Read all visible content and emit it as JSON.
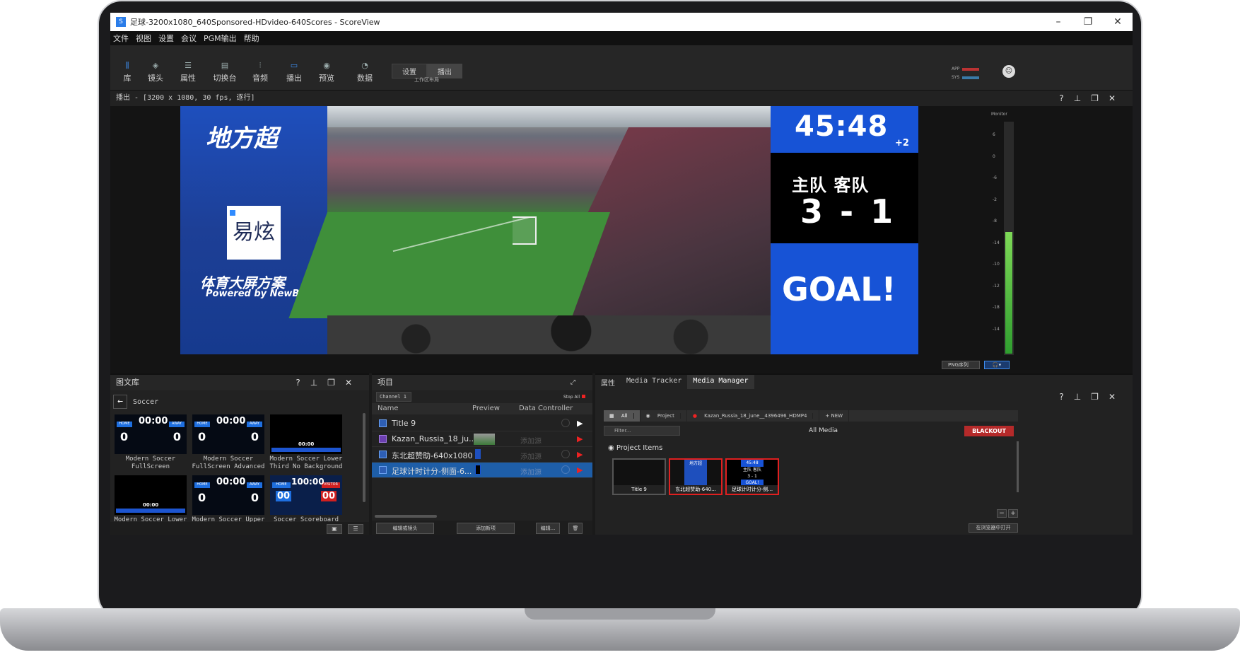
{
  "window": {
    "title": "足球-3200x1080_640Sponsored-HDvideo-640Scores - ScoreView",
    "app_icon": "scoreview-app-icon"
  },
  "menu": [
    "文件",
    "视图",
    "设置",
    "会议",
    "PGM输出",
    "帮助"
  ],
  "toolbar": {
    "tools": [
      {
        "label": "库",
        "icon": "library-icon"
      },
      {
        "label": "镜头",
        "icon": "layers-icon"
      },
      {
        "label": "属性",
        "icon": "list-icon"
      },
      {
        "label": "切换台",
        "icon": "switcher-icon"
      },
      {
        "label": "音频",
        "icon": "audio-sliders-icon"
      },
      {
        "label": "播出",
        "icon": "monitor-icon"
      },
      {
        "label": "预览",
        "icon": "eye-icon"
      },
      {
        "label": "数据",
        "icon": "data-icon"
      }
    ],
    "layout_tabs": [
      "设置",
      "播出"
    ],
    "layout_caption": "工作区布局",
    "meters": [
      "APP",
      "SYS"
    ]
  },
  "program": {
    "header": "播出 - [3200 x 1080, 30 fps, 逐行]",
    "left": {
      "title": "地方超",
      "logo_text": "易炫",
      "subtitle": "体育大屏方案",
      "powered": "Powered by NewBlue"
    },
    "right": {
      "clock": "45:48",
      "added": "+2",
      "teams": "主队  客队",
      "score": "3 - 1",
      "goal": "GOAL!"
    },
    "monitor": {
      "title": "Monitor",
      "scale": [
        "6",
        "0",
        "-6",
        "-2",
        "-8",
        "-14",
        "-10",
        "-12",
        "-18",
        "-14"
      ]
    },
    "png_button": "PNG序列"
  },
  "library": {
    "title": "图文库",
    "folder": "Soccer",
    "items": [
      {
        "label": "Modern Soccer FullScreen",
        "clock": "00:00",
        "home": "0",
        "away": "0"
      },
      {
        "label": "Modern Soccer FullScreen Advanced",
        "clock": "00:00",
        "home": "0",
        "away": "0"
      },
      {
        "label": "Modern Soccer Lower Third No Background",
        "clock": "00:00",
        "home": "",
        "away": ""
      },
      {
        "label": "Modern Soccer Lower",
        "clock": "00:00",
        "home": "",
        "away": ""
      },
      {
        "label": "Modern Soccer Upper",
        "clock": "00:00",
        "home": "0",
        "away": "0"
      },
      {
        "label": "Soccer Scoreboard",
        "clock": "100:00",
        "home": "00",
        "away": "00"
      }
    ],
    "tag_home": "HOME",
    "tag_away": "AWAY",
    "tag_visitor": "VISITOR"
  },
  "project": {
    "title": "项目",
    "channel": "Channel 1",
    "stop_all": "Stop All",
    "columns": [
      "Name",
      "Preview",
      "Data Controller"
    ],
    "rows": [
      {
        "name": "Title 9",
        "add": ""
      },
      {
        "name": "Kazan_Russia_18_ju...",
        "add": "添加源"
      },
      {
        "name": "东北超赞助-640x1080",
        "add": "添加源"
      },
      {
        "name": "足球计时计分-侧面-6...",
        "add": "添加源"
      }
    ],
    "buttons": [
      "编辑或镜头",
      "添加新项",
      "编辑..."
    ]
  },
  "media": {
    "tabs": [
      "属性",
      "Media Tracker",
      "Media Manager"
    ],
    "filters": [
      "All",
      "Project",
      "Kazan_Russia_18_june__4396496_HDMP4",
      "+ NEW"
    ],
    "filter_placeholder": "Filter...",
    "heading": "All Media",
    "blackout": "BLACKOUT",
    "section": "Project Items",
    "items": [
      "Title 9",
      "东北超赞助-640...",
      "足球计时计分-侧..."
    ],
    "mini_clock": "45:48",
    "mini_teams": "主队 客队",
    "mini_score": "3 - 1",
    "mini_goal": "GOAL!",
    "mini_title": "地方超",
    "open_button": "在浏览器中打开"
  }
}
